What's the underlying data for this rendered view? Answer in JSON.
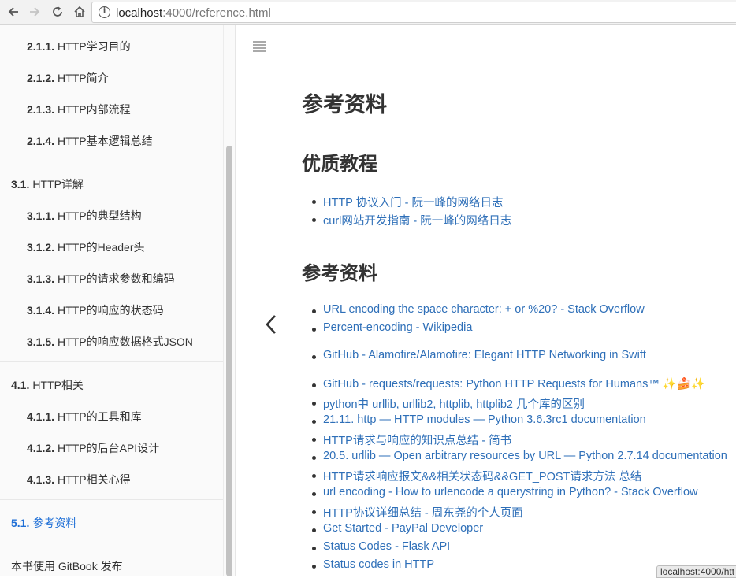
{
  "browser": {
    "url_host": "localhost",
    "url_rest": ":4000/reference.html"
  },
  "sidebar": {
    "items": [
      {
        "num": "2.1.1.",
        "label": "HTTP学习目的"
      },
      {
        "num": "2.1.2.",
        "label": "HTTP简介"
      },
      {
        "num": "2.1.3.",
        "label": "HTTP内部流程"
      },
      {
        "num": "2.1.4.",
        "label": "HTTP基本逻辑总结"
      },
      {
        "num": "3.1.",
        "label": "HTTP详解"
      },
      {
        "num": "3.1.1.",
        "label": "HTTP的典型结构"
      },
      {
        "num": "3.1.2.",
        "label": "HTTP的Header头"
      },
      {
        "num": "3.1.3.",
        "label": "HTTP的请求参数和编码"
      },
      {
        "num": "3.1.4.",
        "label": "HTTP的响应的状态码"
      },
      {
        "num": "3.1.5.",
        "label": "HTTP的响应数据格式JSON"
      },
      {
        "num": "4.1.",
        "label": "HTTP相关"
      },
      {
        "num": "4.1.1.",
        "label": "HTTP的工具和库"
      },
      {
        "num": "4.1.2.",
        "label": "HTTP的后台API设计"
      },
      {
        "num": "4.1.3.",
        "label": "HTTP相关心得"
      },
      {
        "num": "5.1.",
        "label": "参考资料"
      }
    ],
    "footer": "本书使用 GitBook 发布"
  },
  "main": {
    "title": "参考资料",
    "section1": "优质教程",
    "section1_links": [
      "HTTP 协议入门 - 阮一峰的网络日志",
      "curl网站开发指南 - 阮一峰的网络日志"
    ],
    "section2": "参考资料",
    "section2_links": [
      "URL encoding the space character: + or %20? - Stack Overflow",
      "Percent-encoding - Wikipedia",
      "GitHub - Alamofire/Alamofire: Elegant HTTP Networking in Swift",
      "GitHub - requests/requests: Python HTTP Requests for Humans™ ✨🍰✨",
      "python中 urllib, urllib2, httplib, httplib2 几个库的区别",
      "21.11. http — HTTP modules — Python 3.6.3rc1 documentation",
      "HTTP请求与响应的知识点总结 - 简书",
      "20.5. urllib — Open arbitrary resources by URL — Python 2.7.14 documentation",
      "HTTP请求响应报文&&相关状态码&&GET_POST请求方法 总结",
      "url encoding - How to urlencode a querystring in Python? - Stack Overflow",
      "HTTP协议详细总结 - 周东尧的个人页面",
      "Get Started - PayPal Developer",
      "Status Codes - Flask API",
      "Status codes in HTTP"
    ]
  },
  "status_bar": "localhost:4000/htt",
  "colors": {
    "link": "#2e6fb8",
    "active": "#1f6fd6"
  }
}
